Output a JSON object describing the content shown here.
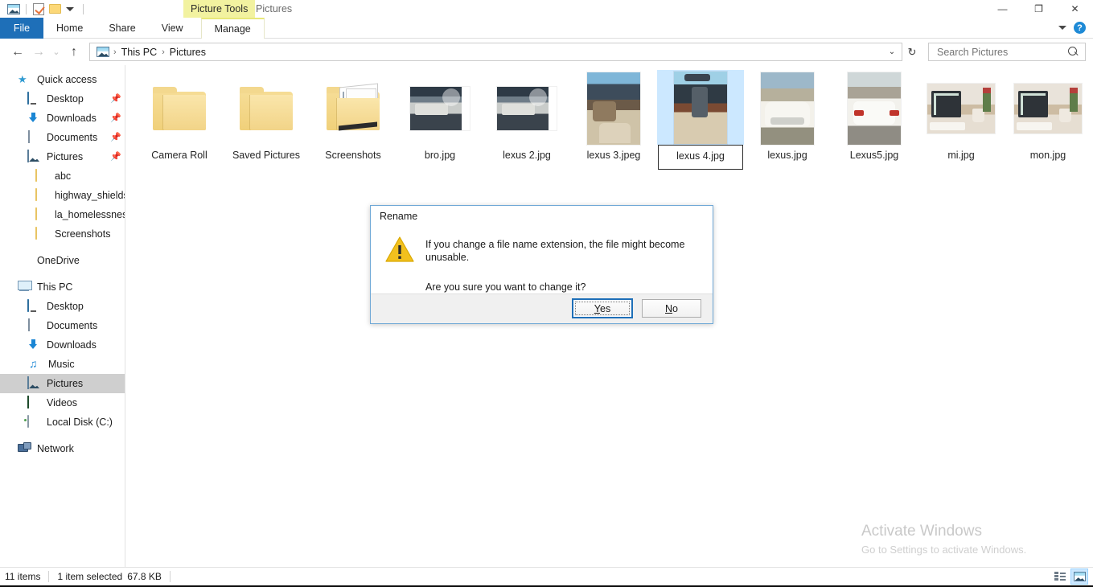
{
  "window": {
    "title": "Pictures",
    "contextual_tab_badge": "Picture Tools",
    "quick_access_icons": [
      "pictures-icon",
      "properties-icon",
      "new-folder-icon",
      "customize-caret-icon"
    ],
    "controls": {
      "minimize": "—",
      "restore": "❐",
      "close": "✕"
    },
    "ribbon_collapse": "chevron-down-icon",
    "help": "?"
  },
  "ribbon": {
    "tabs": [
      {
        "label": "File",
        "state": "file"
      },
      {
        "label": "Home",
        "state": "normal"
      },
      {
        "label": "Share",
        "state": "normal"
      },
      {
        "label": "View",
        "state": "normal"
      },
      {
        "label": "Manage",
        "state": "active-contextual"
      }
    ]
  },
  "addressbar": {
    "back": "←",
    "forward": "→",
    "recent": "⌄",
    "up": "↑",
    "crumbs": [
      "This PC",
      "Pictures"
    ],
    "separator": "›",
    "dropdown": "⌄",
    "refresh": "↻",
    "search": {
      "placeholder": "Search Pictures",
      "value": ""
    }
  },
  "navpane": {
    "groups": [
      {
        "header": {
          "label": "Quick access",
          "icon": "star-icon",
          "indent": 0
        },
        "items": [
          {
            "label": "Desktop",
            "icon": "monitor-icon",
            "indent": 1,
            "pinned": true
          },
          {
            "label": "Downloads",
            "icon": "download-icon",
            "indent": 1,
            "pinned": true
          },
          {
            "label": "Documents",
            "icon": "document-icon",
            "indent": 1,
            "pinned": true
          },
          {
            "label": "Pictures",
            "icon": "pictures-icon",
            "indent": 1,
            "pinned": true
          },
          {
            "label": "abc",
            "icon": "folder-icon",
            "indent": 2,
            "pinned": false
          },
          {
            "label": "highway_shields",
            "icon": "folder-icon",
            "indent": 2,
            "pinned": false
          },
          {
            "label": "la_homelessness.gp",
            "icon": "folder-icon",
            "indent": 2,
            "pinned": false
          },
          {
            "label": "Screenshots",
            "icon": "folder-icon",
            "indent": 2,
            "pinned": false
          }
        ]
      },
      {
        "header": {
          "label": "OneDrive",
          "icon": "cloud-icon",
          "indent": 0
        },
        "items": []
      },
      {
        "header": {
          "label": "This PC",
          "icon": "pc-icon",
          "indent": 0
        },
        "items": [
          {
            "label": "Desktop",
            "icon": "monitor-icon",
            "indent": 1,
            "pinned": false
          },
          {
            "label": "Documents",
            "icon": "document-icon",
            "indent": 1,
            "pinned": false
          },
          {
            "label": "Downloads",
            "icon": "download-icon",
            "indent": 1,
            "pinned": false
          },
          {
            "label": "Music",
            "icon": "music-icon",
            "indent": 1,
            "pinned": false
          },
          {
            "label": "Pictures",
            "icon": "pictures-icon",
            "indent": 1,
            "pinned": false,
            "selected": true
          },
          {
            "label": "Videos",
            "icon": "video-icon",
            "indent": 1,
            "pinned": false
          },
          {
            "label": "Local Disk (C:)",
            "icon": "disk-icon",
            "indent": 1,
            "pinned": false
          }
        ]
      },
      {
        "header": {
          "label": "Network",
          "icon": "network-icon",
          "indent": 0
        },
        "items": []
      }
    ]
  },
  "files": [
    {
      "name": "Camera Roll",
      "kind": "folder",
      "selected": false,
      "renaming": false
    },
    {
      "name": "Saved Pictures",
      "kind": "folder",
      "selected": false,
      "renaming": false
    },
    {
      "name": "Screenshots",
      "kind": "folder-screenshots",
      "selected": false,
      "renaming": false
    },
    {
      "name": "bro.jpg",
      "kind": "photo-engine",
      "selected": false,
      "renaming": false
    },
    {
      "name": "lexus 2.jpg",
      "kind": "photo-engine",
      "selected": false,
      "renaming": false
    },
    {
      "name": "lexus 3.jpeg",
      "kind": "photo-interior",
      "selected": false,
      "renaming": false
    },
    {
      "name": "lexus 4.jpg",
      "kind": "photo-dash",
      "selected": true,
      "renaming": true
    },
    {
      "name": "lexus.jpg",
      "kind": "photo-car-front",
      "selected": false,
      "renaming": false
    },
    {
      "name": "Lexus5.jpg",
      "kind": "photo-car-back",
      "selected": false,
      "renaming": false
    },
    {
      "name": "mi.jpg",
      "kind": "photo-desk",
      "selected": false,
      "renaming": false
    },
    {
      "name": "mon.jpg",
      "kind": "photo-desk",
      "selected": false,
      "renaming": false
    }
  ],
  "statusbar": {
    "item_count": "11 items",
    "selection": "1 item selected",
    "size": "67.8 KB",
    "views": [
      {
        "name": "details-view",
        "active": false
      },
      {
        "name": "large-icons-view",
        "active": true
      }
    ]
  },
  "dialog": {
    "title": "Rename",
    "icon": "warning-icon",
    "line1": "If you change a file name extension, the file might become unusable.",
    "line2": "Are you sure you want to change it?",
    "buttons": [
      {
        "label": "Yes",
        "accel": "Y",
        "default": true
      },
      {
        "label": "No",
        "accel": "N",
        "default": false
      }
    ]
  },
  "watermark": {
    "title": "Activate Windows",
    "subtitle": "Go to Settings to activate Windows."
  },
  "colors": {
    "accent": "#1e6fb8",
    "selection": "#cce8ff",
    "contextual_tab": "#f2f2a0",
    "folder": "#fcd878"
  }
}
